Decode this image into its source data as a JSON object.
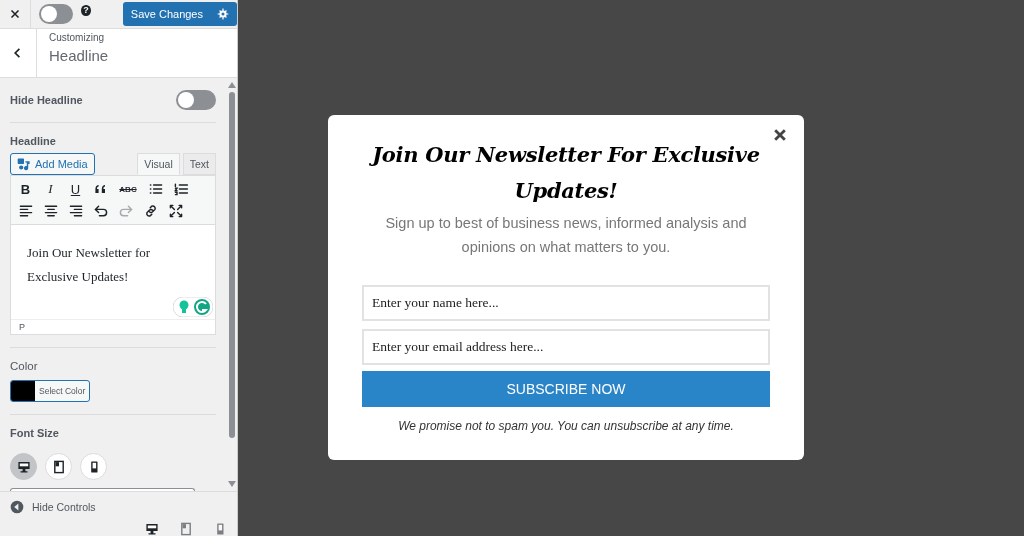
{
  "topbar": {
    "preview_toggle": {
      "on": false
    },
    "help": "?",
    "save_button": "Save Changes"
  },
  "header": {
    "breadcrumb": "Customizing",
    "title": "Headline"
  },
  "hide_headline": {
    "label": "Hide Headline",
    "on": false
  },
  "headline": {
    "label": "Headline",
    "add_media": "Add Media",
    "tabs": [
      {
        "label": "Visual",
        "selected": true
      },
      {
        "label": "Text",
        "selected": false
      }
    ],
    "toolbar": [
      [
        {
          "kind": "bold",
          "label": "B"
        },
        {
          "kind": "italic",
          "label": "I"
        },
        {
          "kind": "underline",
          "label": "U"
        },
        {
          "kind": "quote"
        },
        {
          "kind": "strike",
          "label": "ABC"
        },
        {
          "kind": "bullets"
        },
        {
          "kind": "numbers"
        }
      ],
      [
        {
          "kind": "align-left"
        },
        {
          "kind": "align-center"
        },
        {
          "kind": "align-right"
        },
        {
          "kind": "undo",
          "disabled": false
        },
        {
          "kind": "redo",
          "disabled": true
        },
        {
          "kind": "link"
        },
        {
          "kind": "fullscreen"
        }
      ]
    ],
    "content": "Join Our Newsletter for Exclusive Updates!",
    "path": "P"
  },
  "color": {
    "label": "Color",
    "color": "#000000",
    "button": "Select Color"
  },
  "font_size": {
    "label": "Font Size",
    "devices": [
      {
        "kind": "desktop",
        "selected": true
      },
      {
        "kind": "tablet",
        "selected": false
      },
      {
        "kind": "mobile",
        "selected": false
      }
    ]
  },
  "footer": {
    "hide_controls": "Hide Controls",
    "devices": [
      {
        "kind": "desktop",
        "selected": true
      },
      {
        "kind": "tablet",
        "selected": false
      },
      {
        "kind": "mobile",
        "selected": false
      }
    ]
  },
  "popup": {
    "title": "Join Our Newsletter For Exclusive Updates!",
    "subtitle": "Sign up to best of business news, informed analysis and opinions on what matters to you.",
    "fields": [
      {
        "placeholder": "Enter your name here..."
      },
      {
        "placeholder": "Enter your email address here..."
      }
    ],
    "button": "SUBSCRIBE NOW",
    "note": "We promise not to spam you. You can unsubscribe at any time."
  }
}
